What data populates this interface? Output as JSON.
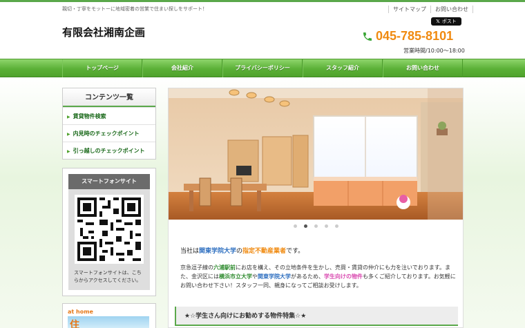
{
  "header": {
    "tagline": "親切・丁寧をモットーに地域密着の営業で住まい探しをサポート！",
    "links": [
      "サイトマップ",
      "お問い合わせ"
    ],
    "post_button": "ポスト",
    "company_name": "有限会社湘南企画",
    "phone": "045-785-8101",
    "hours": "営業時間/10:00～18:00"
  },
  "nav": {
    "items": [
      "トップページ",
      "会社紹介",
      "プライバシーポリシー",
      "スタッフ紹介",
      "お問い合わせ"
    ]
  },
  "sidebar": {
    "contents_title": "コンテンツ一覧",
    "menu": [
      "賃貸物件検索",
      "内見時のチェックポイント",
      "引っ越しのチェックポイント"
    ],
    "smartphone_title": "スマートフォンサイト",
    "smartphone_text": "スマートフォンサイトは、こちらからアクセスしてください。",
    "athome_logo": "at home",
    "athome_char": "住"
  },
  "slider": {
    "dots": 5,
    "active_index": 1
  },
  "main": {
    "intro_1": "当社は",
    "intro_2": "関東学院大学",
    "intro_3": "の",
    "intro_4": "指定不動産業者",
    "intro_5": "です。",
    "para_1": "京急逗子線の",
    "para_2": "六浦駅前",
    "para_3": "にお店を構え、その立地条件を生かし、売買・賃貸の仲介にも力を注いでおります。また、金沢区には",
    "para_4": "横浜市立大学",
    "para_5": "や",
    "para_6": "関東学院大学",
    "para_7": "があるため、",
    "para_8": "学生向けの物件",
    "para_9": "も多くご紹介しております。お気軽にお問い合わせ下さい！スタッフ一同、親身になってご相談お受けします。",
    "feature_title": "★☆学生さん向けにお勧めする物件特集☆★"
  }
}
